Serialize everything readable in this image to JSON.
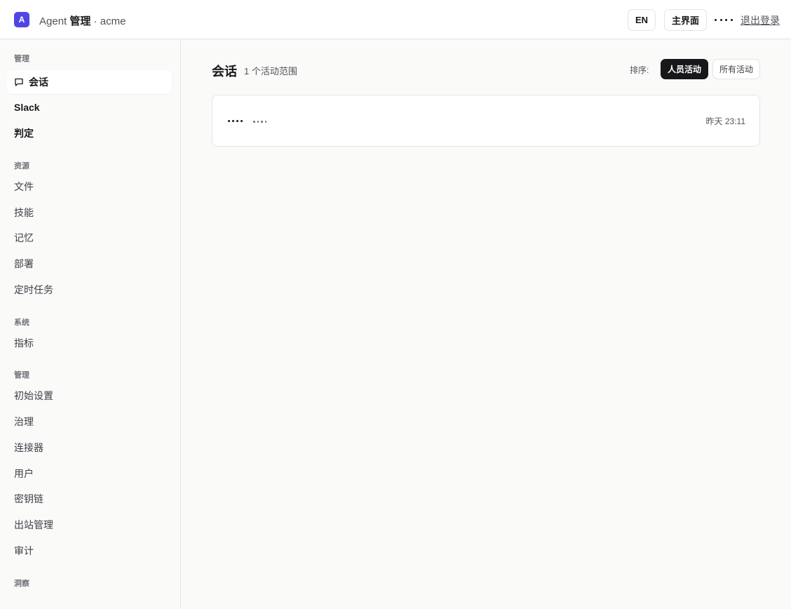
{
  "header": {
    "logo_letter": "A",
    "brand_prefix": "Agent",
    "brand_strong": "管理",
    "brand_suffix": "· acme",
    "lang_button": "EN",
    "main_button": "主界面",
    "more_icon": "more-dots-icon",
    "logout": "退出登录"
  },
  "sidebar": {
    "sections": [
      {
        "label": "管理",
        "items": [
          {
            "label": "会话",
            "icon": "chat-icon",
            "active": true
          },
          {
            "label": "Slack",
            "bold": true
          },
          {
            "label": "判定",
            "bold": true
          }
        ]
      },
      {
        "label": "资源",
        "items": [
          {
            "label": "文件"
          },
          {
            "label": "技能"
          },
          {
            "label": "记忆"
          },
          {
            "label": "部署"
          },
          {
            "label": "定时任务"
          }
        ]
      },
      {
        "label": "系统",
        "items": [
          {
            "label": "指标"
          }
        ]
      },
      {
        "label": "管理",
        "items": [
          {
            "label": "初始设置"
          },
          {
            "label": "治理"
          },
          {
            "label": "连接器"
          },
          {
            "label": "用户"
          },
          {
            "label": "密钥链"
          },
          {
            "label": "出站管理"
          },
          {
            "label": "审计"
          }
        ]
      },
      {
        "label": "洞察",
        "items": []
      }
    ]
  },
  "main": {
    "title": "会话",
    "subtitle": "1 个活动范围",
    "sort_label": "排序:",
    "sort_options": [
      {
        "label": "人员活动",
        "selected": true
      },
      {
        "label": "所有活动",
        "selected": false
      }
    ],
    "sessions": [
      {
        "time": "昨天 23:11"
      }
    ]
  },
  "colors": {
    "accent": "#4f46e5",
    "primary_dark": "#18181b",
    "panel_bg": "#fafaf9",
    "border": "#e4e4e7"
  }
}
